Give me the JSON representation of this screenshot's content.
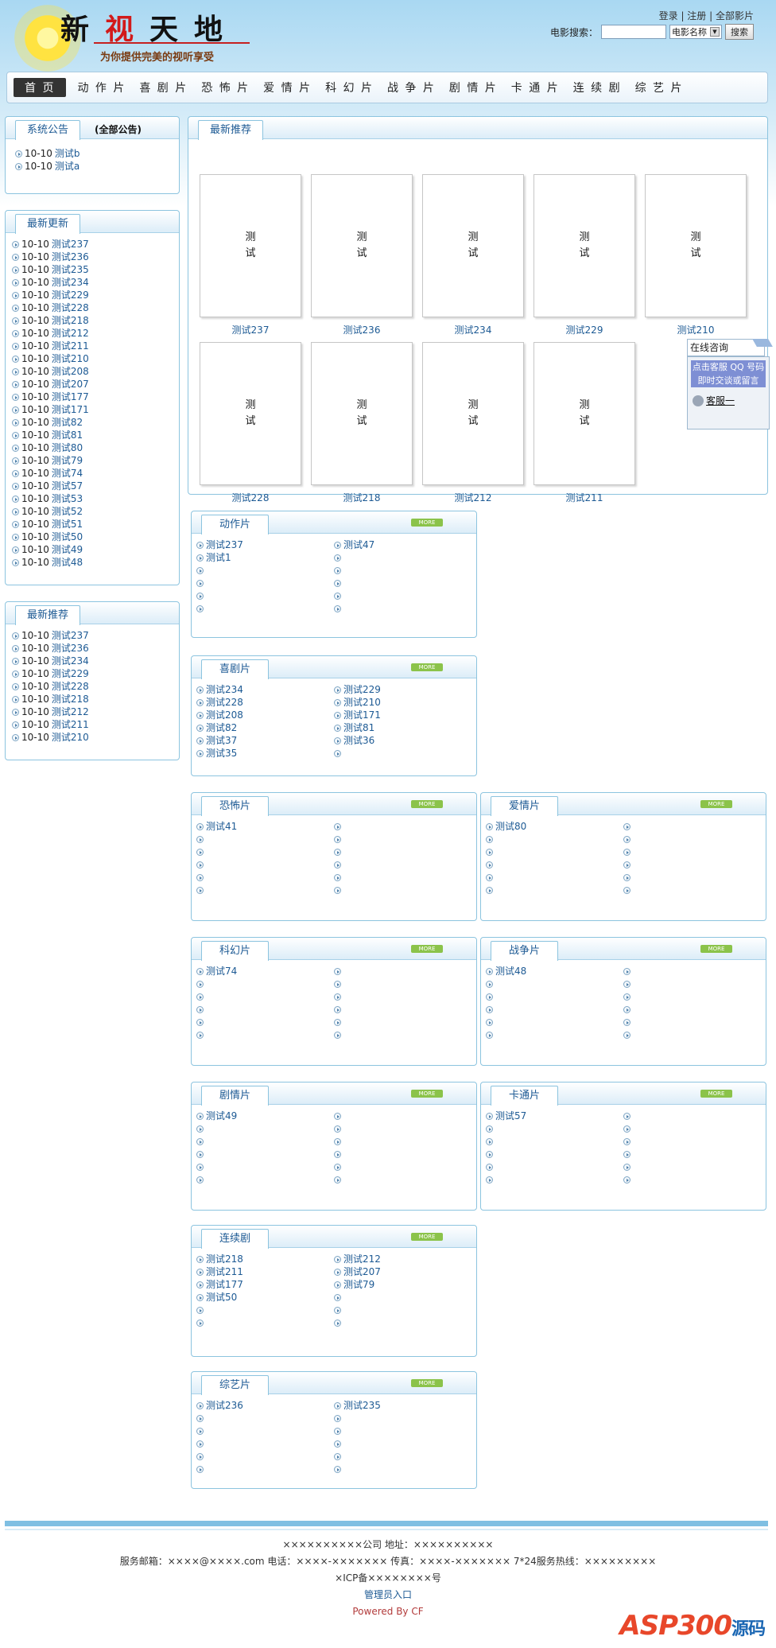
{
  "header": {
    "logo_chars": [
      "新",
      "视",
      "天",
      "地"
    ],
    "slogan": "为你提供完美的视听享受",
    "links": [
      "登录",
      "注册",
      "全部影片"
    ],
    "search_label": "电影搜索：",
    "search_placeholder": "",
    "search_field": "电影名称",
    "search_button": "搜索"
  },
  "nav": {
    "home": "首 页",
    "items": [
      "动 作 片",
      "喜 剧 片",
      "恐 怖 片",
      "爱 情 片",
      "科 幻 片",
      "战 争 片",
      "剧 情 片",
      "卡 通 片",
      "连 续 剧",
      "综 艺 片"
    ]
  },
  "sidebar": {
    "notice": {
      "title": "系统公告",
      "all": "(全部公告)",
      "items": [
        {
          "date": "10-10",
          "name": "测试b"
        },
        {
          "date": "10-10",
          "name": "测试a"
        }
      ]
    },
    "latest": {
      "title": "最新更新",
      "items": [
        {
          "date": "10-10",
          "name": "测试237"
        },
        {
          "date": "10-10",
          "name": "测试236"
        },
        {
          "date": "10-10",
          "name": "测试235"
        },
        {
          "date": "10-10",
          "name": "测试234"
        },
        {
          "date": "10-10",
          "name": "测试229"
        },
        {
          "date": "10-10",
          "name": "测试228"
        },
        {
          "date": "10-10",
          "name": "测试218"
        },
        {
          "date": "10-10",
          "name": "测试212"
        },
        {
          "date": "10-10",
          "name": "测试211"
        },
        {
          "date": "10-10",
          "name": "测试210"
        },
        {
          "date": "10-10",
          "name": "测试208"
        },
        {
          "date": "10-10",
          "name": "测试207"
        },
        {
          "date": "10-10",
          "name": "测试177"
        },
        {
          "date": "10-10",
          "name": "测试171"
        },
        {
          "date": "10-10",
          "name": "测试82"
        },
        {
          "date": "10-10",
          "name": "测试81"
        },
        {
          "date": "10-10",
          "name": "测试80"
        },
        {
          "date": "10-10",
          "name": "测试79"
        },
        {
          "date": "10-10",
          "name": "测试74"
        },
        {
          "date": "10-10",
          "name": "测试57"
        },
        {
          "date": "10-10",
          "name": "测试53"
        },
        {
          "date": "10-10",
          "name": "测试52"
        },
        {
          "date": "10-10",
          "name": "测试51"
        },
        {
          "date": "10-10",
          "name": "测试50"
        },
        {
          "date": "10-10",
          "name": "测试49"
        },
        {
          "date": "10-10",
          "name": "测试48"
        }
      ]
    },
    "recommend": {
      "title": "最新推荐",
      "items": [
        {
          "date": "10-10",
          "name": "测试237"
        },
        {
          "date": "10-10",
          "name": "测试236"
        },
        {
          "date": "10-10",
          "name": "测试234"
        },
        {
          "date": "10-10",
          "name": "测试229"
        },
        {
          "date": "10-10",
          "name": "测试228"
        },
        {
          "date": "10-10",
          "name": "测试218"
        },
        {
          "date": "10-10",
          "name": "测试212"
        },
        {
          "date": "10-10",
          "name": "测试211"
        },
        {
          "date": "10-10",
          "name": "测试210"
        }
      ]
    }
  },
  "featured": {
    "title": "最新推荐",
    "poster_text": "测\n试",
    "items": [
      "测试237",
      "测试236",
      "测试234",
      "测试229",
      "测试210",
      "测试228",
      "测试218",
      "测试212",
      "测试211"
    ]
  },
  "more_label": "MORE",
  "categories": [
    {
      "title": "动作片",
      "left": [
        "测试237",
        "测试1",
        "",
        "",
        "",
        ""
      ],
      "right": [
        "测试47",
        "",
        "",
        "",
        "",
        ""
      ]
    },
    {
      "title": "喜剧片",
      "left": [
        "测试234",
        "测试228",
        "测试208",
        "测试82",
        "测试37",
        "测试35"
      ],
      "right": [
        "测试229",
        "测试210",
        "测试171",
        "测试81",
        "测试36",
        ""
      ]
    },
    {
      "title": "恐怖片",
      "left": [
        "测试41",
        "",
        "",
        "",
        "",
        ""
      ],
      "right": [
        "",
        "",
        "",
        "",
        "",
        ""
      ]
    },
    {
      "title": "爱情片",
      "left": [
        "测试80",
        "",
        "",
        "",
        "",
        ""
      ],
      "right": [
        "",
        "",
        "",
        "",
        "",
        ""
      ]
    },
    {
      "title": "科幻片",
      "left": [
        "测试74",
        "",
        "",
        "",
        "",
        ""
      ],
      "right": [
        "",
        "",
        "",
        "",
        "",
        ""
      ]
    },
    {
      "title": "战争片",
      "left": [
        "测试48",
        "",
        "",
        "",
        "",
        ""
      ],
      "right": [
        "",
        "",
        "",
        "",
        "",
        ""
      ]
    },
    {
      "title": "剧情片",
      "left": [
        "测试49",
        "",
        "",
        "",
        "",
        ""
      ],
      "right": [
        "",
        "",
        "",
        "",
        "",
        ""
      ]
    },
    {
      "title": "卡通片",
      "left": [
        "测试57",
        "",
        "",
        "",
        "",
        ""
      ],
      "right": [
        "",
        "",
        "",
        "",
        "",
        ""
      ]
    },
    {
      "title": "连续剧",
      "left": [
        "测试218",
        "测试211",
        "测试177",
        "测试50",
        "",
        ""
      ],
      "right": [
        "测试212",
        "测试207",
        "测试79",
        "",
        "",
        ""
      ]
    },
    {
      "title": "综艺片",
      "left": [
        "测试236",
        "",
        "",
        "",
        "",
        ""
      ],
      "right": [
        "测试235",
        "",
        "",
        "",
        "",
        ""
      ]
    }
  ],
  "qq": {
    "title": "在线咨询",
    "note": "点击客服 QQ 号码 即时交谈或留言",
    "name": "客服一"
  },
  "footer": {
    "line1": "××××××××××公司 地址：××××××××××",
    "line2": "服务邮箱：××××@××××.com 电话：××××-××××××× 传真：××××-××××××× 7*24服务热线：×××××××××",
    "line3": "×ICP备××××××××号",
    "admin": "管理员入口",
    "powered": "Powered By CF"
  },
  "watermark": "ASP300源码",
  "colors": {
    "accent": "#1d5a94",
    "border": "#8cc4df",
    "more": "#8bc34a"
  }
}
